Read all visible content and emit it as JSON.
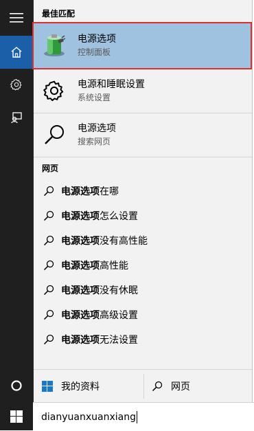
{
  "rail": {
    "menu_icon": "hamburger-icon",
    "home_icon": "home-icon",
    "settings_icon": "gear-icon",
    "feedback_icon": "feedback-icon",
    "cortana_icon": "cortana-circle-icon",
    "start_icon": "windows-logo-icon"
  },
  "sections": {
    "best_match": "最佳匹配",
    "web": "网页"
  },
  "results": [
    {
      "title": "电源选项",
      "subtitle": "控制面板",
      "icon": "battery-power-icon"
    },
    {
      "title": "电源和睡眠设置",
      "subtitle": "系统设置",
      "icon": "gear-icon"
    },
    {
      "title": "电源选项",
      "subtitle": "搜索网页",
      "icon": "search-icon"
    }
  ],
  "web_suggestions": [
    {
      "bold": "电源选项",
      "rest": "在哪"
    },
    {
      "bold": "电源选项",
      "rest": "怎么设置"
    },
    {
      "bold": "电源选项",
      "rest": "没有高性能"
    },
    {
      "bold": "电源选项",
      "rest": "高性能"
    },
    {
      "bold": "电源选项",
      "rest": "没有休眠"
    },
    {
      "bold": "电源选项",
      "rest": "高级设置"
    },
    {
      "bold": "电源选项",
      "rest": "无法设置"
    }
  ],
  "bottom": {
    "my_stuff": "我的资料",
    "web": "网页"
  },
  "search": {
    "value": "dianyuanxuanxiang"
  },
  "colors": {
    "accent": "#1a5fa8",
    "selected": "#9fc2e0",
    "highlight_border": "#e02d2d"
  }
}
